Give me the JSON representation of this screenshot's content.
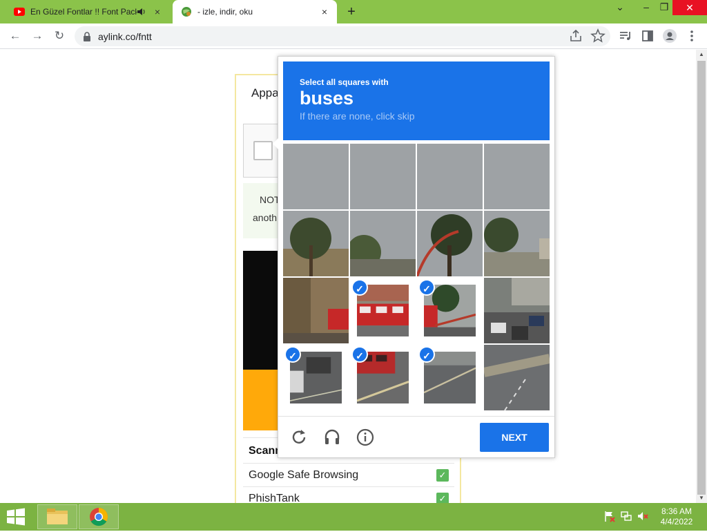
{
  "browser": {
    "tabs": [
      {
        "title": "En Güzel Fontlar !! Font Pack",
        "close": "×"
      },
      {
        "title": "- izle, indir, oku",
        "close": "×"
      }
    ],
    "new_tab": "+",
    "window_controls": {
      "dropdown": "⌄",
      "minimize": "–",
      "restore": "❐",
      "close": "✕"
    },
    "nav": {
      "back": "←",
      "forward": "→",
      "reload": "↻"
    },
    "url": "aylink.co/fntt"
  },
  "page": {
    "card_title": "Appa",
    "note_line1": "NOT",
    "note_line2": "anoth",
    "scan_header": "Scann",
    "scan_rows": [
      {
        "label": "Google Safe Browsing",
        "status": "✓"
      },
      {
        "label": "PhishTank",
        "status": "✓"
      }
    ]
  },
  "captcha": {
    "instruction": "Select all squares with",
    "target": "buses",
    "hint": "If there are none, click skip",
    "checkmark": "✓",
    "next_label": "NEXT",
    "tiles_selected": [
      false,
      false,
      false,
      false,
      false,
      false,
      false,
      false,
      false,
      true,
      true,
      false,
      true,
      true,
      true,
      false
    ]
  },
  "taskbar": {
    "time": "8:36 AM",
    "date": "4/4/2022"
  }
}
